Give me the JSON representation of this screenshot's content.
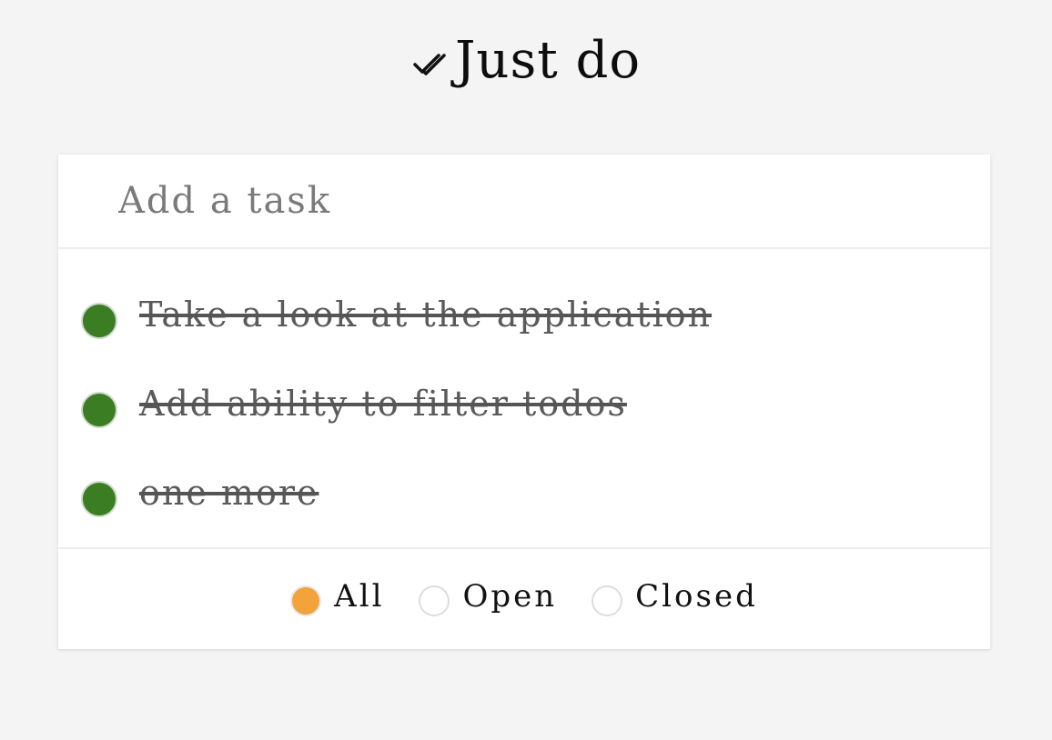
{
  "app": {
    "title": "Just do"
  },
  "input": {
    "placeholder": "Add a task",
    "value": ""
  },
  "tasks": [
    {
      "text": "Take a look at the application",
      "done": true
    },
    {
      "text": "Add ability to filter todos",
      "done": true
    },
    {
      "text": "one more",
      "done": true
    }
  ],
  "filters": {
    "options": [
      "All",
      "Open",
      "Closed"
    ],
    "selected": "All"
  },
  "colors": {
    "background": "#f4f4f4",
    "card": "#ffffff",
    "done_dot": "#3a7d22",
    "selected_filter": "#f2a33c",
    "text_muted": "#5a5a5a"
  },
  "icons": {
    "logo": "double-check-icon"
  }
}
